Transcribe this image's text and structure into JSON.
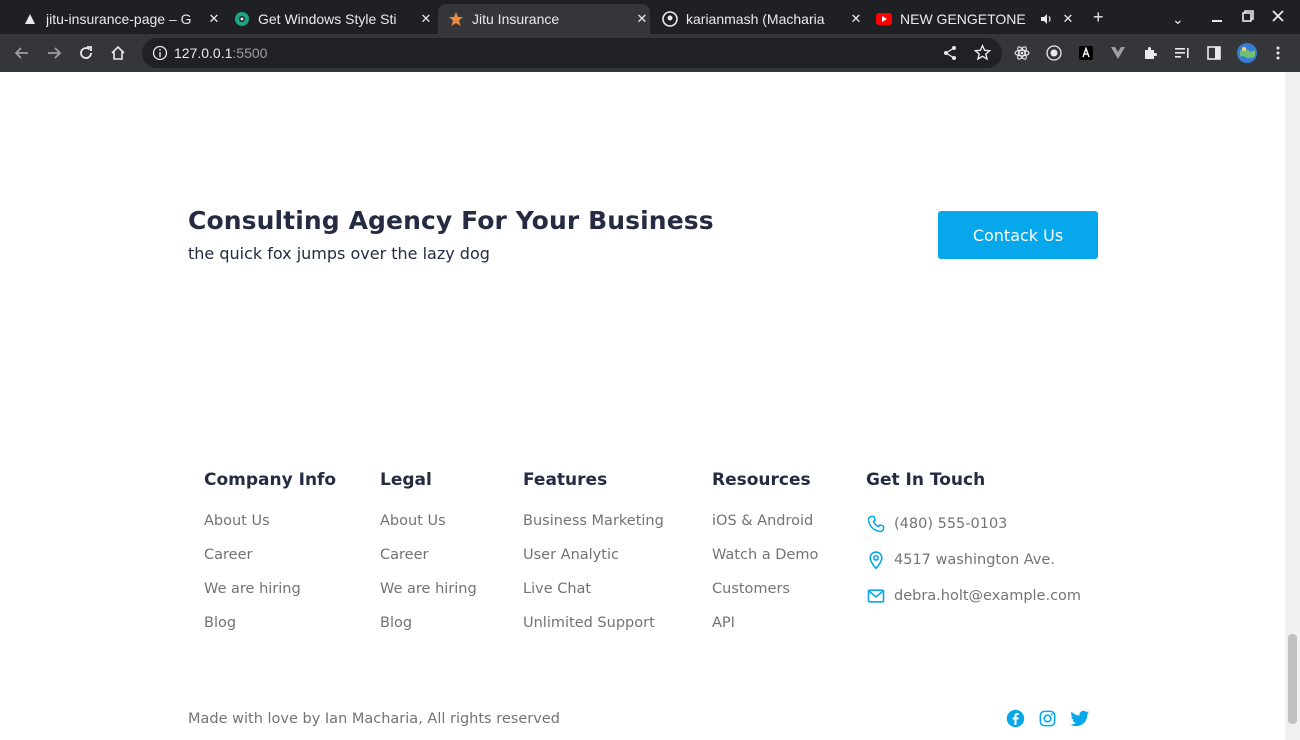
{
  "browser": {
    "tabs": [
      {
        "title": "jitu-insurance-page – G",
        "favicon": "triangle-icon"
      },
      {
        "title": "Get Windows Style Sti",
        "favicon": "gear-icon"
      },
      {
        "title": "Jitu Insurance",
        "favicon": "star-icon"
      },
      {
        "title": "karianmash (Macharia",
        "favicon": "github-icon"
      },
      {
        "title": "NEW GENGETONE",
        "favicon": "youtube-icon"
      }
    ],
    "url_host": "127.0.0.1",
    "url_port": ":5500"
  },
  "cta": {
    "title": "Consulting Agency For Your Business",
    "subtitle": "the quick fox jumps over the lazy dog",
    "button": "Contack Us"
  },
  "footer": {
    "columns": [
      {
        "heading": "Company Info",
        "links": [
          "About Us",
          "Career",
          "We are hiring",
          "Blog"
        ]
      },
      {
        "heading": "Legal",
        "links": [
          "About Us",
          "Career",
          "We are hiring",
          "Blog"
        ]
      },
      {
        "heading": "Features",
        "links": [
          "Business Marketing",
          "User Analytic",
          "Live Chat",
          "Unlimited Support"
        ]
      },
      {
        "heading": "Resources",
        "links": [
          "iOS & Android",
          "Watch a Demo",
          "Customers",
          "API"
        ]
      }
    ],
    "contact": {
      "heading": "Get In Touch",
      "phone": "(480) 555-0103",
      "address": "4517 washington Ave.",
      "email": "debra.holt@example.com"
    },
    "note": "Made with love by Ian Macharia, All rights reserved",
    "social": [
      "facebook-icon",
      "instagram-icon",
      "twitter-icon"
    ]
  },
  "colors": {
    "accent": "#06a7eb",
    "heading": "#252b42",
    "muted": "#737373",
    "chrome_dark": "#1f2023",
    "chrome_toolbar": "#35363a"
  }
}
